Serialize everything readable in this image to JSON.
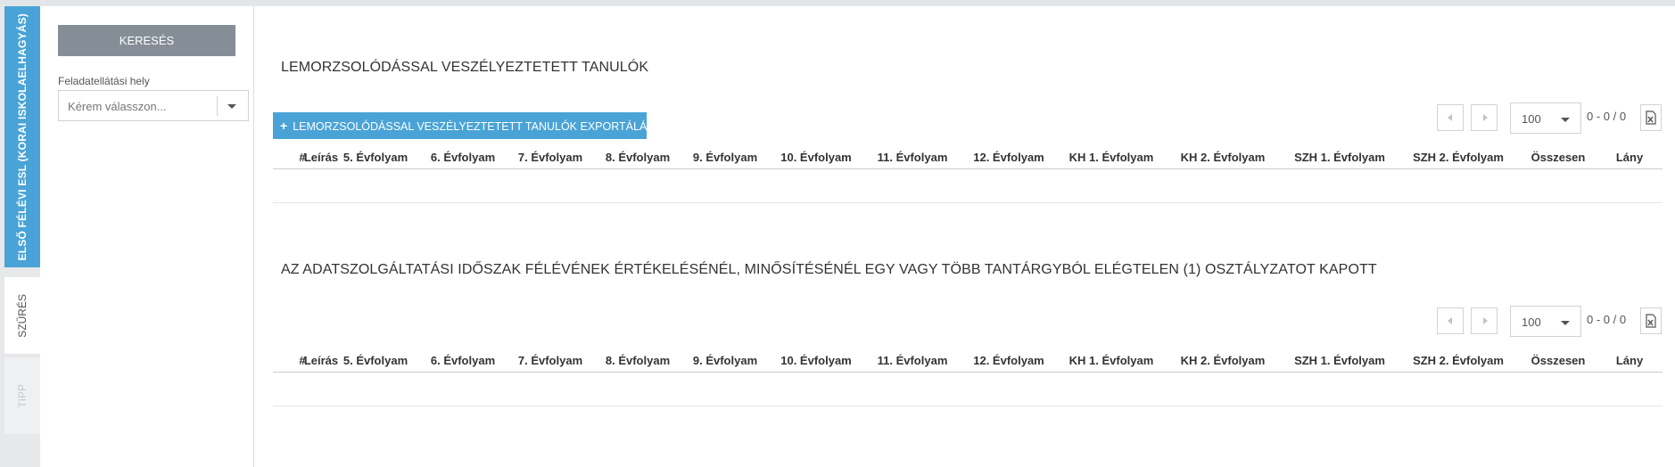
{
  "tabs": [
    {
      "label": "ELSŐ FÉLÉVI ESL (KORAI ISKOLAELHAGYÁS)",
      "active": true
    },
    {
      "label": "SZŰRÉS"
    },
    {
      "label": "TIPP"
    }
  ],
  "filter": {
    "search_label": "KERESÉS",
    "field_label": "Feladatellátási hely",
    "placeholder": "Kérem válasszon..."
  },
  "columns": [
    "#",
    "Leírás",
    "5. Évfolyam",
    "6. Évfolyam",
    "7. Évfolyam",
    "8. Évfolyam",
    "9. Évfolyam",
    "10. Évfolyam",
    "11. Évfolyam",
    "12. Évfolyam",
    "KH 1. Évfolyam",
    "KH 2. Évfolyam",
    "SZH 1. Évfolyam",
    "SZH 2. Évfolyam",
    "Összesen",
    "Lány"
  ],
  "sections": [
    {
      "title": "LEMORZSOLÓDÁSSAL VESZÉLYEZTETETT TANULÓK",
      "export_label": "LEMORZSOLÓDÁSSAL VESZÉLYEZTETETT TANULÓK EXPORTÁLÁSA",
      "page_size": "100",
      "range": "0 - 0 / 0"
    },
    {
      "title": "AZ ADATSZOLGÁLTATÁSI IDŐSZAK FÉLÉVÉNEK ÉRTÉKELÉSÉNÉL, MINŐSÍTÉSÉNÉL EGY VAGY TÖBB TANTÁRGYBÓL ELÉGTELEN (1) OSZTÁLYZATOT KAPOTT",
      "page_size": "100",
      "range": "0 - 0 / 0"
    }
  ],
  "colors": {
    "accent": "#4aa3d6",
    "search_button": "#858e96"
  },
  "icons": {
    "plus": "+",
    "prev": "chevron-left-icon",
    "next": "chevron-right-icon",
    "export": "excel-export-icon"
  }
}
